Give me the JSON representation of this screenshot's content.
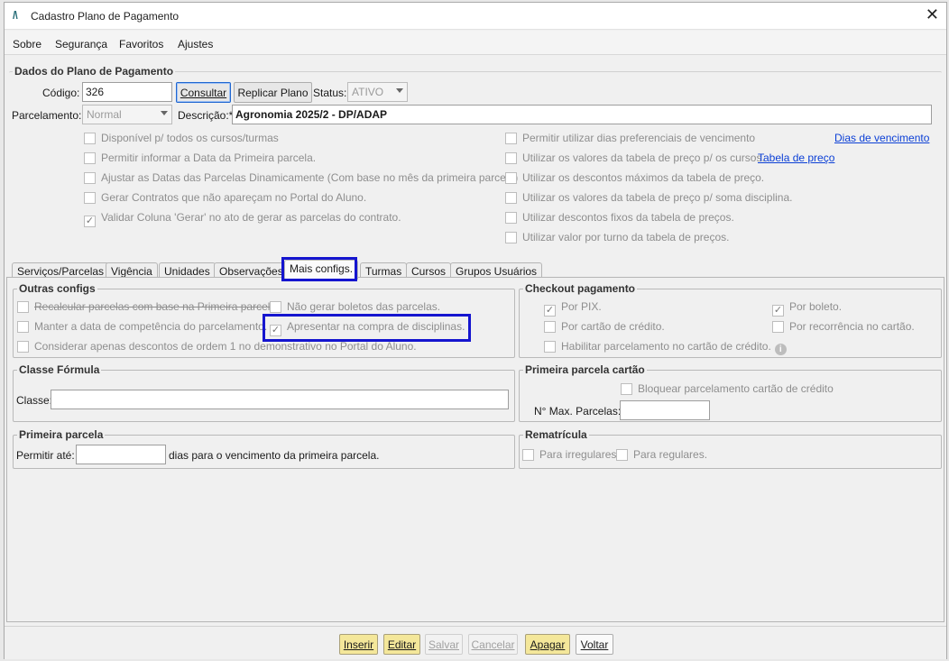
{
  "window": {
    "title": "Cadastro Plano de Pagamento",
    "logo": "/\\",
    "close": "✕"
  },
  "menu": {
    "sobre": "Sobre",
    "seguranca": "Segurança",
    "favoritos": "Favoritos",
    "ajustes": "Ajustes"
  },
  "dados": {
    "title": "Dados do Plano de Pagamento",
    "codigo_label": "Código:",
    "codigo_value": "326",
    "consultar": "Consultar",
    "replicar": "Replicar Plano",
    "status_label": "Status:",
    "status_value": "ATIVO",
    "parcelamento_label": "Parcelamento:",
    "parcelamento_value": "Normal",
    "descricao_label": "Descrição:*",
    "descricao_value": "Agronomia 2025/2 - DP/ADAP",
    "left_checks": [
      {
        "label": "Disponível p/ todos os cursos/turmas",
        "checked": false
      },
      {
        "label": "Permitir informar a Data da Primeira parcela.",
        "checked": false
      },
      {
        "label": "Ajustar as Datas das Parcelas Dinamicamente (Com base no mês da primeira parcela)",
        "checked": false
      },
      {
        "label": "Gerar Contratos que não apareçam no Portal do Aluno.",
        "checked": false
      },
      {
        "label": "Validar Coluna 'Gerar' no ato de gerar as parcelas do contrato.",
        "checked": true
      }
    ],
    "right_checks": [
      {
        "label": "Permitir utilizar dias preferenciais de vencimento",
        "checked": false
      },
      {
        "label": "Utilizar os valores da tabela de preço p/ os cursos.",
        "checked": false
      },
      {
        "label": "Utilizar os descontos máximos da tabela de preço.",
        "checked": false
      },
      {
        "label": "Utilizar os valores da tabela de preço p/ soma disciplina.",
        "checked": false
      },
      {
        "label": "Utilizar descontos fixos da tabela de preços.",
        "checked": false
      },
      {
        "label": "Utilizar valor por turno da tabela de preços.",
        "checked": false
      }
    ],
    "dias_link": "Dias de vencimento",
    "tabela_link": "Tabela de preço"
  },
  "tabs": [
    "Serviços/Parcelas",
    "Vigência",
    "Unidades",
    "Observações",
    "Mais configs.",
    "Turmas",
    "Cursos",
    "Grupos Usuários"
  ],
  "outras": {
    "title": "Outras configs",
    "recalcular": "Recalcular parcelas com base na Primeira parcela.",
    "nao_gerar": "Não gerar boletos das parcelas.",
    "manter": "Manter a data de competência do parcelamento.",
    "apresentar": "Apresentar na compra de disciplinas.",
    "considerar": "Considerar apenas descontos de ordem 1 no demonstrativo no Portal do Aluno."
  },
  "checkout": {
    "title": "Checkout pagamento",
    "pix": "Por PIX.",
    "boleto": "Por boleto.",
    "cartao": "Por cartão de crédito.",
    "recorrencia": "Por recorrência no cartão.",
    "habilitar": "Habilitar parcelamento no cartão de crédito.",
    "info": "i"
  },
  "classe": {
    "title": "Classe Fórmula",
    "label": "Classe:",
    "value": ""
  },
  "primeira_cartao": {
    "title": "Primeira parcela cartão",
    "bloquear": "Bloquear parcelamento cartão de crédito",
    "max_label": "N° Max. Parcelas:",
    "max_value": ""
  },
  "primeira": {
    "title": "Primeira parcela",
    "label": "Permitir até:",
    "value": "",
    "suffix": "dias para o vencimento da primeira parcela."
  },
  "rematricula": {
    "title": "Rematrícula",
    "irregulares": "Para irregulares.",
    "regulares": "Para regulares."
  },
  "footer": {
    "inserir": "Inserir",
    "editar": "Editar",
    "salvar": "Salvar",
    "cancelar": "Cancelar",
    "apagar": "Apagar",
    "voltar": "Voltar"
  },
  "colors": {
    "accent": "#1515cf",
    "link": "#0b3fd6",
    "yellow_button": "#f4e79a"
  }
}
